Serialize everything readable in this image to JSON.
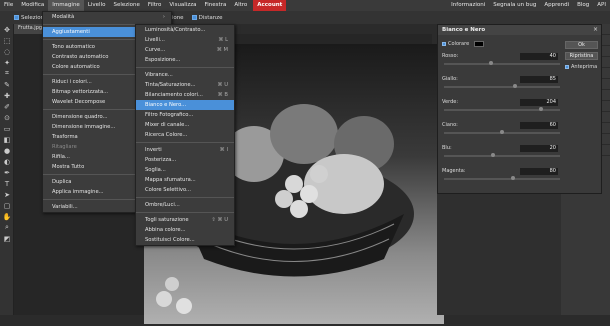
{
  "menubar": {
    "items": [
      "File",
      "Modifica",
      "Immagine",
      "Livello",
      "Selezione",
      "Filtro",
      "Visualizza",
      "Finestra",
      "Altro",
      "Account"
    ],
    "right": [
      "Informazioni",
      "Segnala un bug",
      "Apprendi",
      "Blog",
      "API"
    ]
  },
  "optbar": {
    "selezione_label": "Selezion",
    "trasformazione_label": "trasformazione",
    "distanze_label": "Distanze"
  },
  "doctab": {
    "name": "Frutta.jpg",
    "close": "×"
  },
  "immagine_menu": [
    {
      "label": "Modalità",
      "sub": true
    },
    {
      "sep": true
    },
    {
      "label": "Aggiustamenti",
      "sub": true,
      "active": true
    },
    {
      "sep": true
    },
    {
      "label": "Tono automatico"
    },
    {
      "label": "Contrasto automatico"
    },
    {
      "label": "Colore automatico"
    },
    {
      "sep": true
    },
    {
      "label": "Riduci i colori..."
    },
    {
      "label": "Bitmap vettorizzata..."
    },
    {
      "label": "Wavelet Decompose"
    },
    {
      "sep": true
    },
    {
      "label": "Dimensione quadro...",
      "sc": "⌥ ⌘ C"
    },
    {
      "label": "Dimensione immagine...",
      "sc": "⌥ ⌘ I"
    },
    {
      "label": "Trasforma",
      "sub": true
    },
    {
      "label": "Ritagliare",
      "dim": true
    },
    {
      "label": "Rifila...",
      "sc": "⌘ ."
    },
    {
      "label": "Mostra Tutto"
    },
    {
      "sep": true
    },
    {
      "label": "Duplica"
    },
    {
      "label": "Applica immagine..."
    },
    {
      "sep": true
    },
    {
      "label": "Variabili..."
    }
  ],
  "aggiustamenti_menu": [
    {
      "label": "Luminosità/Contrasto..."
    },
    {
      "label": "Livelli...",
      "sc": "⌘ L"
    },
    {
      "label": "Curve...",
      "sc": "⌘ M"
    },
    {
      "label": "Esposizione..."
    },
    {
      "sep": true
    },
    {
      "label": "Vibrance..."
    },
    {
      "label": "Tinta/Saturazione...",
      "sc": "⌘ U"
    },
    {
      "label": "Bilanciamento colori...",
      "sc": "⌘ B"
    },
    {
      "label": "Bianco e Nero...",
      "sel": true
    },
    {
      "label": "Filtro Fotografico..."
    },
    {
      "label": "Mixer di canale..."
    },
    {
      "label": "Ricerca Colore..."
    },
    {
      "sep": true
    },
    {
      "label": "Inverti",
      "sc": "⌘ I"
    },
    {
      "label": "Posterizza..."
    },
    {
      "label": "Soglia..."
    },
    {
      "label": "Mappa sfumatura..."
    },
    {
      "label": "Colore Selettivo..."
    },
    {
      "sep": true
    },
    {
      "label": "Ombre/Luci..."
    },
    {
      "sep": true
    },
    {
      "label": "Togli saturazione",
      "sc": "⇧ ⌘ U"
    },
    {
      "label": "Abbina colore..."
    },
    {
      "label": "Sostituisci Colore..."
    }
  ],
  "dialog": {
    "title": "Bianco e Nero",
    "close": "×",
    "colorare_label": "Colorare",
    "sliders": [
      {
        "label": "Rosso:",
        "value": "40",
        "level": 0.4
      },
      {
        "label": "Giallo:",
        "value": "85",
        "level": 0.62
      },
      {
        "label": "Verde:",
        "value": "204",
        "level": 0.85
      },
      {
        "label": "Ciano:",
        "value": "60",
        "level": 0.5
      },
      {
        "label": "Blu:",
        "value": "20",
        "level": 0.42
      },
      {
        "label": "Magenta:",
        "value": "80",
        "level": 0.6
      }
    ],
    "ok": "Ok",
    "reset": "Ripristina",
    "preview": "Anteprima"
  },
  "sidecol": [
    "Cronolog",
    "Scambiar",
    "Livelli",
    "Canali",
    "Percorsi",
    "Info",
    "Propriet",
    "CSS",
    "Pennelli",
    "Caratteri",
    "Paragrafo",
    "Appendi"
  ]
}
